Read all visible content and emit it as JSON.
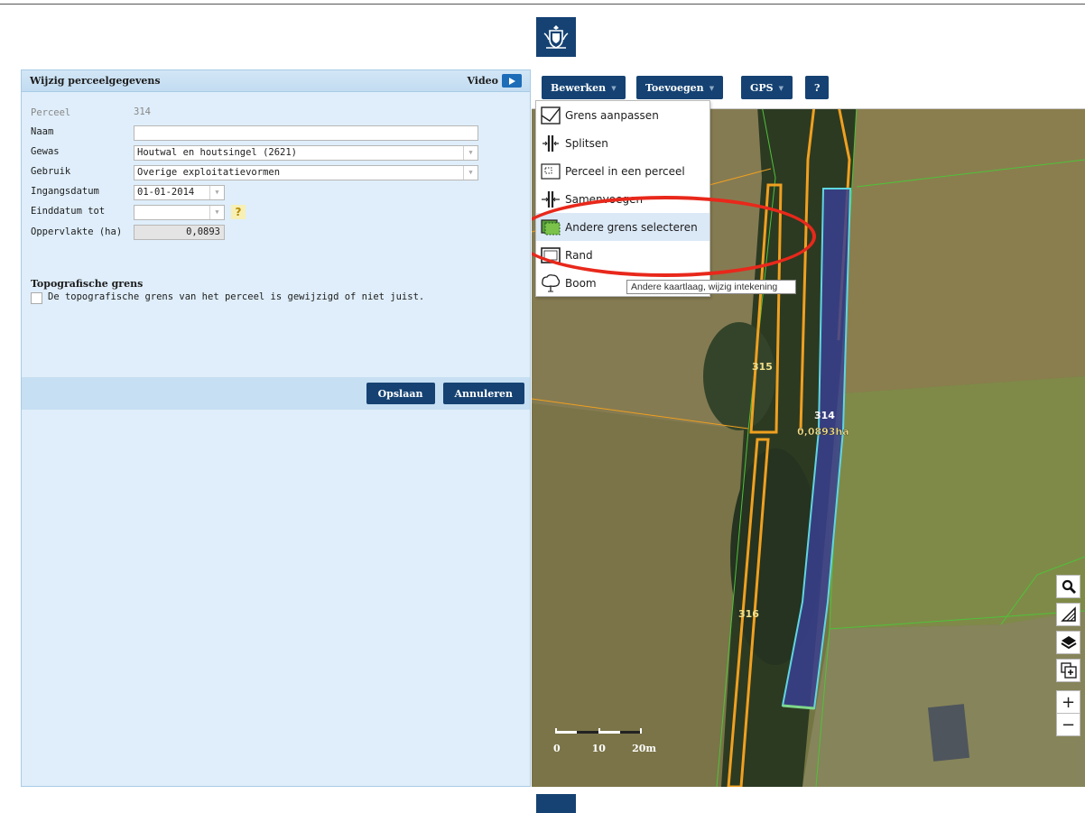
{
  "header": {
    "crest_icon": "royal-coat-of-arms-icon",
    "brand_color": "#154273"
  },
  "panel": {
    "title": "Wijzig perceelgegevens",
    "video_label": "Video",
    "fields": {
      "perceel_label": "Perceel",
      "perceel_value": "314",
      "naam_label": "Naam",
      "naam_value": "",
      "gewas_label": "Gewas",
      "gewas_value": "Houtwal en houtsingel (2621)",
      "gebruik_label": "Gebruik",
      "gebruik_value": "Overige exploitatievormen",
      "ingangsdatum_label": "Ingangsdatum",
      "ingangsdatum_value": "01-01-2014",
      "einddatum_label": "Einddatum tot",
      "einddatum_value": "",
      "help_label": "?",
      "oppervlakte_label": "Oppervlakte (ha)",
      "oppervlakte_value": "0,0893"
    },
    "topo": {
      "title": "Topografische grens",
      "checkbox_label": "De topografische grens van het perceel is gewijzigd of niet juist.",
      "checked": false
    },
    "buttons": {
      "save": "Opslaan",
      "cancel": "Annuleren"
    }
  },
  "map": {
    "toolbar": {
      "edit": "Bewerken",
      "add": "Toevoegen",
      "gps": "GPS",
      "help": "?"
    },
    "menu": [
      {
        "label": "Grens aanpassen",
        "icon": "edit-boundary-icon"
      },
      {
        "label": "Splitsen",
        "icon": "split-icon"
      },
      {
        "label": "Perceel in een perceel",
        "icon": "parcel-in-parcel-icon"
      },
      {
        "label": "Samenvoegen",
        "icon": "merge-icon"
      },
      {
        "label": "Andere grens selecteren",
        "icon": "select-other-boundary-icon",
        "highlighted": true
      },
      {
        "label": "Rand",
        "icon": "border-icon"
      },
      {
        "label": "Boom",
        "icon": "tree-icon"
      }
    ],
    "tooltip": "Andere kaartlaag, wijzig intekening",
    "parcel_labels": {
      "p315": "315",
      "p314": "314",
      "p316": "316",
      "area": "0,0893ha"
    },
    "scale_labels": [
      "0",
      "10",
      "20m"
    ],
    "controls": {
      "zoom_in": "+",
      "zoom_out": "−"
    },
    "colors": {
      "selected_parcel_fill": "#3a3f8f",
      "parcel_border": "#f0a020",
      "selected_border": "#5fd6e0",
      "highlight_ring": "#e8281b"
    }
  }
}
